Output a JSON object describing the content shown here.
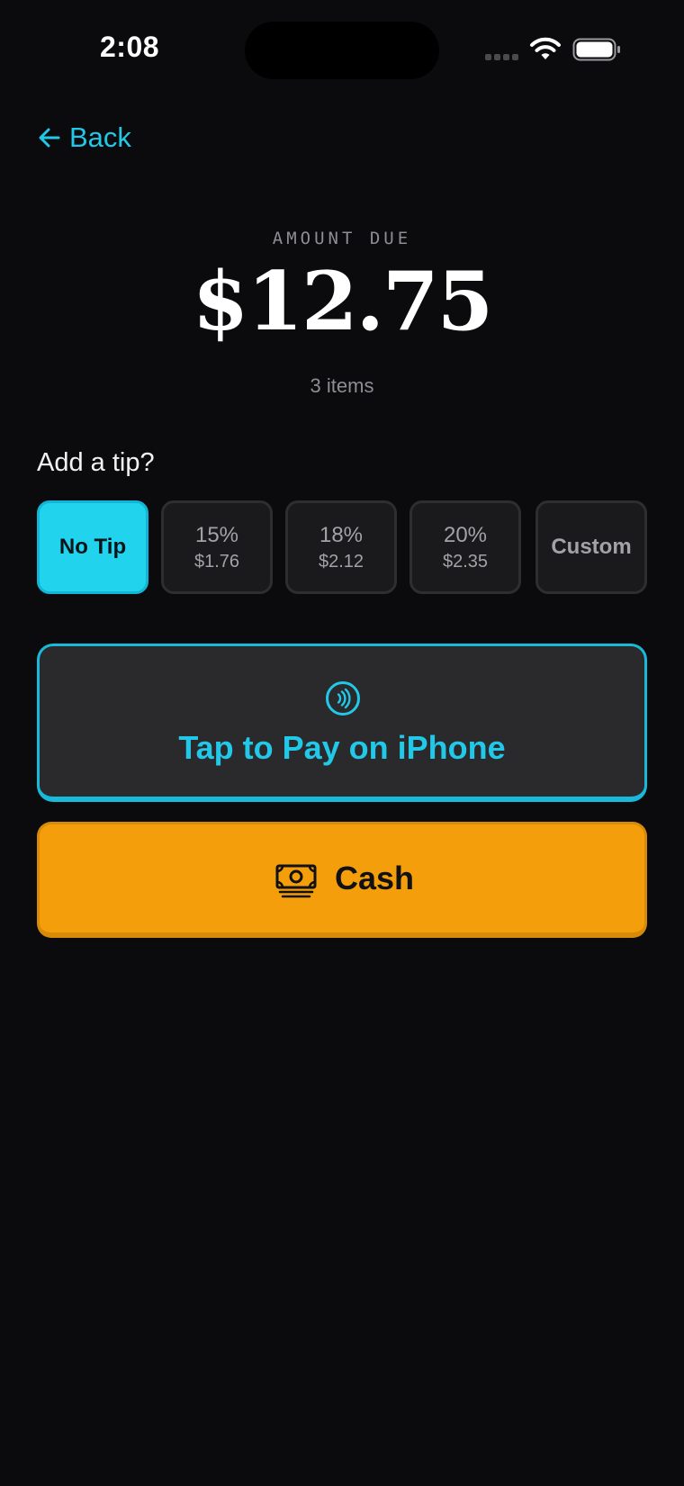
{
  "status_bar": {
    "time": "2:08",
    "signal_icon": "cellular-signal-icon",
    "wifi_icon": "wifi-icon",
    "battery_icon": "battery-icon"
  },
  "nav": {
    "back_label": "Back",
    "back_icon": "arrow-left-icon"
  },
  "amount": {
    "label": "AMOUNT DUE",
    "value": "$12.75",
    "items": "3 items"
  },
  "tip": {
    "heading": "Add a tip?",
    "selected_index": 0,
    "options": [
      {
        "label": "No Tip",
        "amount": ""
      },
      {
        "label": "15%",
        "amount": "$1.76"
      },
      {
        "label": "18%",
        "amount": "$2.12"
      },
      {
        "label": "20%",
        "amount": "$2.35"
      },
      {
        "label": "Custom",
        "amount": ""
      }
    ]
  },
  "payment": {
    "tap_to_pay_label": "Tap to Pay on iPhone",
    "tap_to_pay_icon": "contactless-icon",
    "cash_label": "Cash",
    "cash_icon": "cash-icon"
  },
  "colors": {
    "background": "#0b0b0d",
    "accent": "#22d3ee",
    "cash": "#f59e0b"
  }
}
